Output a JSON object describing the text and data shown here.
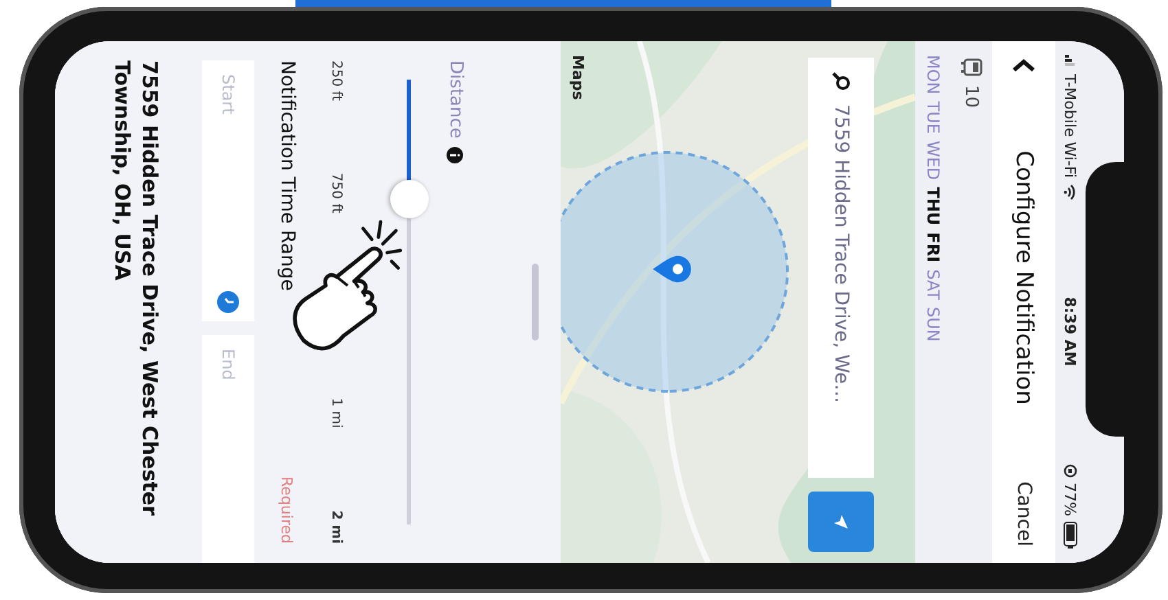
{
  "status_bar": {
    "carrier": "T-Mobile Wi-Fi",
    "time": "8:39 AM",
    "battery": "77%"
  },
  "header": {
    "title": "Configure Notification",
    "cancel": "Cancel"
  },
  "vehicle": {
    "label": "10"
  },
  "days": [
    {
      "label": "MON",
      "selected": false
    },
    {
      "label": "TUE",
      "selected": false
    },
    {
      "label": "WED",
      "selected": false
    },
    {
      "label": "THU",
      "selected": true
    },
    {
      "label": "FRI",
      "selected": true
    },
    {
      "label": "SAT",
      "selected": false
    },
    {
      "label": "SUN",
      "selected": false
    }
  ],
  "map": {
    "search": {
      "value": "7559 Hidden Trace Drive, We…"
    },
    "attribution": "Maps"
  },
  "distance": {
    "label": "Distance",
    "level": 0.27,
    "ticks": [
      "250 ft",
      "750 ft",
      "1 mi",
      "2 mi"
    ]
  },
  "time_range": {
    "label": "Notification Time Range",
    "start": {
      "placeholder": "Start"
    },
    "end": {
      "placeholder": "End"
    },
    "required": "Required"
  },
  "address": "7559 Hidden Trace Drive, West Chester Township, OH, USA"
}
